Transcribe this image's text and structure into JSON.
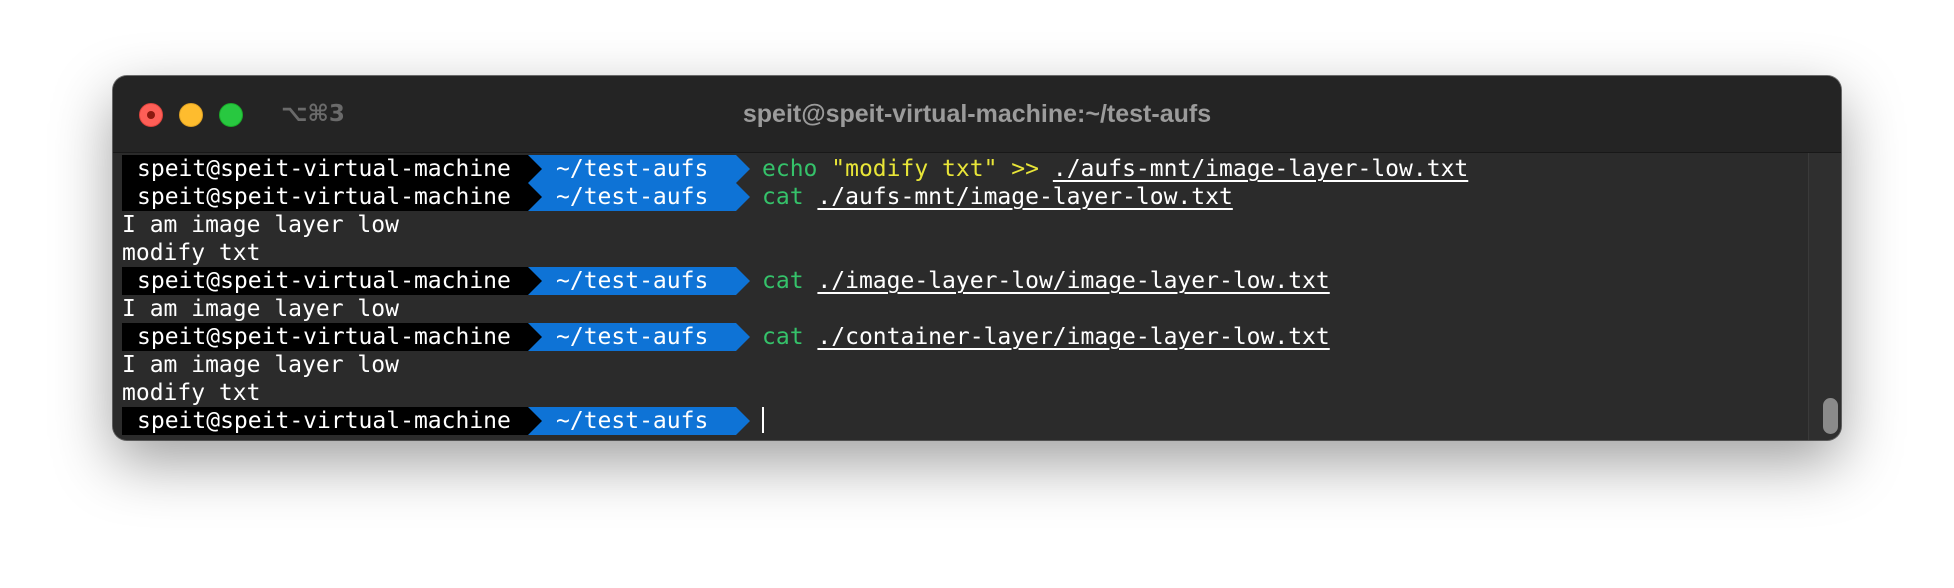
{
  "window": {
    "title": "speit@speit-virtual-machine:~/test-aufs",
    "shortcut": "⌥⌘3"
  },
  "prompt": {
    "user": "speit@speit-virtual-machine",
    "dir": "~/test-aufs"
  },
  "terminal": {
    "l1": {
      "cmd": "echo",
      "arg1": "\"modify txt\"",
      "op": ">>",
      "path": "./aufs-mnt/image-layer-low.txt"
    },
    "l2": {
      "cmd": "cat",
      "path": "./aufs-mnt/image-layer-low.txt"
    },
    "o1": "I am image layer low",
    "o2": "modify txt",
    "l3": {
      "cmd": "cat",
      "path": "./image-layer-low/image-layer-low.txt"
    },
    "o3": "I am image layer low",
    "l4": {
      "cmd": "cat",
      "path": "./container-layer/image-layer-low.txt"
    },
    "o4": "I am image layer low",
    "o5": "modify txt"
  },
  "colors": {
    "prompt_user_bg": "#000000",
    "prompt_dir_bg": "#0e73d6",
    "command": "#35c26a",
    "string": "#e8e538",
    "background": "#2b2b2b"
  }
}
